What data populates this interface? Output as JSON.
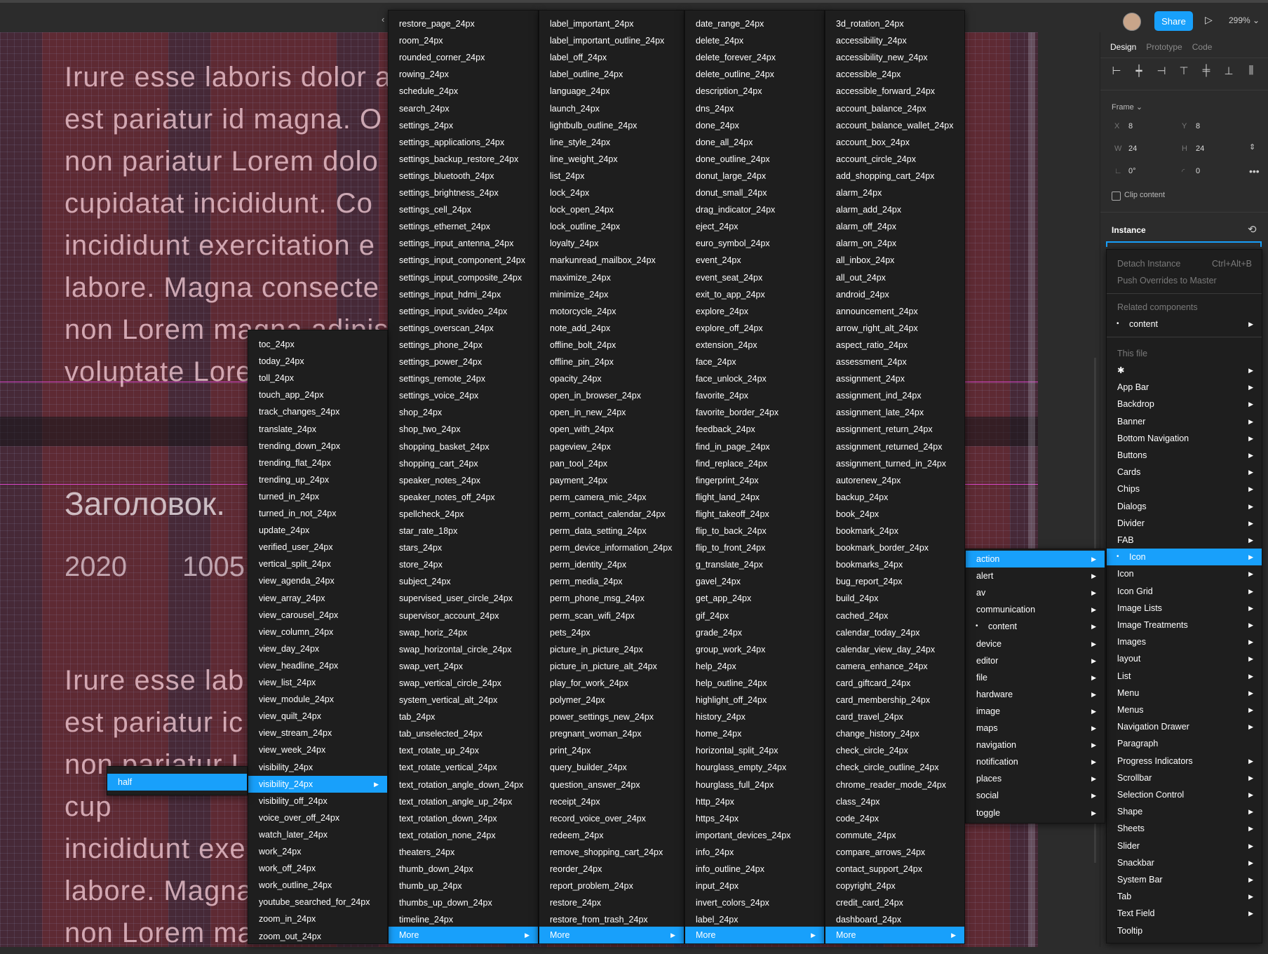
{
  "toolbar": {
    "share_label": "Share",
    "zoom": "299%"
  },
  "canvas": {
    "lines": [
      "Irure esse laboris dolor a",
      "est pariatur id magna. O",
      "non pariatur Lorem dolo",
      "cupidatat incididunt. Co",
      "incididunt exercitation e",
      "labore. Magna consecte",
      "non Lorem magna adipis",
      "voluptate Lore"
    ],
    "heading": "Заголовок.",
    "num1": "2020",
    "num2": "1005",
    "lines2": [
      "Irure esse lab",
      "est pariatur ic",
      "non pariatur L",
      "cup",
      "incididunt exe",
      "labore. Magna",
      "non Lorem ma"
    ]
  },
  "panel": {
    "tabs": [
      "Design",
      "Prototype",
      "Code"
    ],
    "frame_label": "Frame",
    "x_key": "X",
    "x_val": "8",
    "y_key": "Y",
    "y_val": "8",
    "w_key": "W",
    "w_val": "24",
    "h_key": "H",
    "h_val": "24",
    "rot_val": "0°",
    "radius_val": "0",
    "clip_label": "Clip content",
    "instance_label": "Instance"
  },
  "instance_menu": {
    "detach": "Detach Instance",
    "detach_shortcut": "Ctrl+Alt+B",
    "push": "Push Overrides to Master",
    "related_header": "Related components",
    "related_item": "content",
    "this_file_header": "This file",
    "items": [
      "✱",
      "App Bar",
      "Backdrop",
      "Banner",
      "Bottom Navigation",
      "Buttons",
      "Cards",
      "Chips",
      "Dialogs",
      "Divider",
      "FAB",
      "Icon",
      "Icon",
      "Icon Grid",
      "Image Lists",
      "Image Treatments",
      "Images",
      "layout",
      "List",
      "Menu",
      "Menus",
      "Navigation Drawer",
      "Paragraph",
      "Progress Indicators",
      "Scrollbar",
      "Selection Control",
      "Shape",
      "Sheets",
      "Slider",
      "Snackbar",
      "System Bar",
      "Tab",
      "Text Field",
      "Tooltip"
    ]
  },
  "category_menu": {
    "items": [
      "action",
      "alert",
      "av",
      "communication",
      "content",
      "device",
      "editor",
      "file",
      "hardware",
      "image",
      "maps",
      "navigation",
      "notification",
      "places",
      "social",
      "toggle"
    ]
  },
  "half_menu": {
    "label": "half"
  },
  "left_icons": [
    "toc_24px",
    "today_24px",
    "toll_24px",
    "touch_app_24px",
    "track_changes_24px",
    "translate_24px",
    "trending_down_24px",
    "trending_flat_24px",
    "trending_up_24px",
    "turned_in_24px",
    "turned_in_not_24px",
    "update_24px",
    "verified_user_24px",
    "vertical_split_24px",
    "view_agenda_24px",
    "view_array_24px",
    "view_carousel_24px",
    "view_column_24px",
    "view_day_24px",
    "view_headline_24px",
    "view_list_24px",
    "view_module_24px",
    "view_quilt_24px",
    "view_stream_24px",
    "view_week_24px",
    "visibility_24px",
    "visibility_24px",
    "visibility_off_24px",
    "voice_over_off_24px",
    "watch_later_24px",
    "work_24px",
    "work_off_24px",
    "work_outline_24px",
    "youtube_searched_for_24px",
    "zoom_in_24px",
    "zoom_out_24px"
  ],
  "col1": [
    "restore_page_24px",
    "room_24px",
    "rounded_corner_24px",
    "rowing_24px",
    "schedule_24px",
    "search_24px",
    "settings_24px",
    "settings_applications_24px",
    "settings_backup_restore_24px",
    "settings_bluetooth_24px",
    "settings_brightness_24px",
    "settings_cell_24px",
    "settings_ethernet_24px",
    "settings_input_antenna_24px",
    "settings_input_component_24px",
    "settings_input_composite_24px",
    "settings_input_hdmi_24px",
    "settings_input_svideo_24px",
    "settings_overscan_24px",
    "settings_phone_24px",
    "settings_power_24px",
    "settings_remote_24px",
    "settings_voice_24px",
    "shop_24px",
    "shop_two_24px",
    "shopping_basket_24px",
    "shopping_cart_24px",
    "speaker_notes_24px",
    "speaker_notes_off_24px",
    "spellcheck_24px",
    "star_rate_18px",
    "stars_24px",
    "store_24px",
    "subject_24px",
    "supervised_user_circle_24px",
    "supervisor_account_24px",
    "swap_horiz_24px",
    "swap_horizontal_circle_24px",
    "swap_vert_24px",
    "swap_vertical_circle_24px",
    "system_vertical_alt_24px",
    "tab_24px",
    "tab_unselected_24px",
    "text_rotate_up_24px",
    "text_rotate_vertical_24px",
    "text_rotation_angle_down_24px",
    "text_rotation_angle_up_24px",
    "text_rotation_down_24px",
    "text_rotation_none_24px",
    "theaters_24px",
    "thumb_down_24px",
    "thumb_up_24px",
    "thumbs_up_down_24px",
    "timeline_24px"
  ],
  "col2": [
    "label_important_24px",
    "label_important_outline_24px",
    "label_off_24px",
    "label_outline_24px",
    "language_24px",
    "launch_24px",
    "lightbulb_outline_24px",
    "line_style_24px",
    "line_weight_24px",
    "list_24px",
    "lock_24px",
    "lock_open_24px",
    "lock_outline_24px",
    "loyalty_24px",
    "markunread_mailbox_24px",
    "maximize_24px",
    "minimize_24px",
    "motorcycle_24px",
    "note_add_24px",
    "offline_bolt_24px",
    "offline_pin_24px",
    "opacity_24px",
    "open_in_browser_24px",
    "open_in_new_24px",
    "open_with_24px",
    "pageview_24px",
    "pan_tool_24px",
    "payment_24px",
    "perm_camera_mic_24px",
    "perm_contact_calendar_24px",
    "perm_data_setting_24px",
    "perm_device_information_24px",
    "perm_identity_24px",
    "perm_media_24px",
    "perm_phone_msg_24px",
    "perm_scan_wifi_24px",
    "pets_24px",
    "picture_in_picture_24px",
    "picture_in_picture_alt_24px",
    "play_for_work_24px",
    "polymer_24px",
    "power_settings_new_24px",
    "pregnant_woman_24px",
    "print_24px",
    "query_builder_24px",
    "question_answer_24px",
    "receipt_24px",
    "record_voice_over_24px",
    "redeem_24px",
    "remove_shopping_cart_24px",
    "reorder_24px",
    "report_problem_24px",
    "restore_24px",
    "restore_from_trash_24px"
  ],
  "col3": [
    "date_range_24px",
    "delete_24px",
    "delete_forever_24px",
    "delete_outline_24px",
    "description_24px",
    "dns_24px",
    "done_24px",
    "done_all_24px",
    "done_outline_24px",
    "donut_large_24px",
    "donut_small_24px",
    "drag_indicator_24px",
    "eject_24px",
    "euro_symbol_24px",
    "event_24px",
    "event_seat_24px",
    "exit_to_app_24px",
    "explore_24px",
    "explore_off_24px",
    "extension_24px",
    "face_24px",
    "face_unlock_24px",
    "favorite_24px",
    "favorite_border_24px",
    "feedback_24px",
    "find_in_page_24px",
    "find_replace_24px",
    "fingerprint_24px",
    "flight_land_24px",
    "flight_takeoff_24px",
    "flip_to_back_24px",
    "flip_to_front_24px",
    "g_translate_24px",
    "gavel_24px",
    "get_app_24px",
    "gif_24px",
    "grade_24px",
    "group_work_24px",
    "help_24px",
    "help_outline_24px",
    "highlight_off_24px",
    "history_24px",
    "home_24px",
    "horizontal_split_24px",
    "hourglass_empty_24px",
    "hourglass_full_24px",
    "http_24px",
    "https_24px",
    "important_devices_24px",
    "info_24px",
    "info_outline_24px",
    "input_24px",
    "invert_colors_24px",
    "label_24px"
  ],
  "col4": [
    "3d_rotation_24px",
    "accessibility_24px",
    "accessibility_new_24px",
    "accessible_24px",
    "accessible_forward_24px",
    "account_balance_24px",
    "account_balance_wallet_24px",
    "account_box_24px",
    "account_circle_24px",
    "add_shopping_cart_24px",
    "alarm_24px",
    "alarm_add_24px",
    "alarm_off_24px",
    "alarm_on_24px",
    "all_inbox_24px",
    "all_out_24px",
    "android_24px",
    "announcement_24px",
    "arrow_right_alt_24px",
    "aspect_ratio_24px",
    "assessment_24px",
    "assignment_24px",
    "assignment_ind_24px",
    "assignment_late_24px",
    "assignment_return_24px",
    "assignment_returned_24px",
    "assignment_turned_in_24px",
    "autorenew_24px",
    "backup_24px",
    "book_24px",
    "bookmark_24px",
    "bookmark_border_24px",
    "bookmarks_24px",
    "bug_report_24px",
    "build_24px",
    "cached_24px",
    "calendar_today_24px",
    "calendar_view_day_24px",
    "camera_enhance_24px",
    "card_giftcard_24px",
    "card_membership_24px",
    "card_travel_24px",
    "change_history_24px",
    "check_circle_24px",
    "check_circle_outline_24px",
    "chrome_reader_mode_24px",
    "class_24px",
    "code_24px",
    "commute_24px",
    "compare_arrows_24px",
    "contact_support_24px",
    "copyright_24px",
    "credit_card_24px",
    "dashboard_24px"
  ],
  "more_label": "More"
}
